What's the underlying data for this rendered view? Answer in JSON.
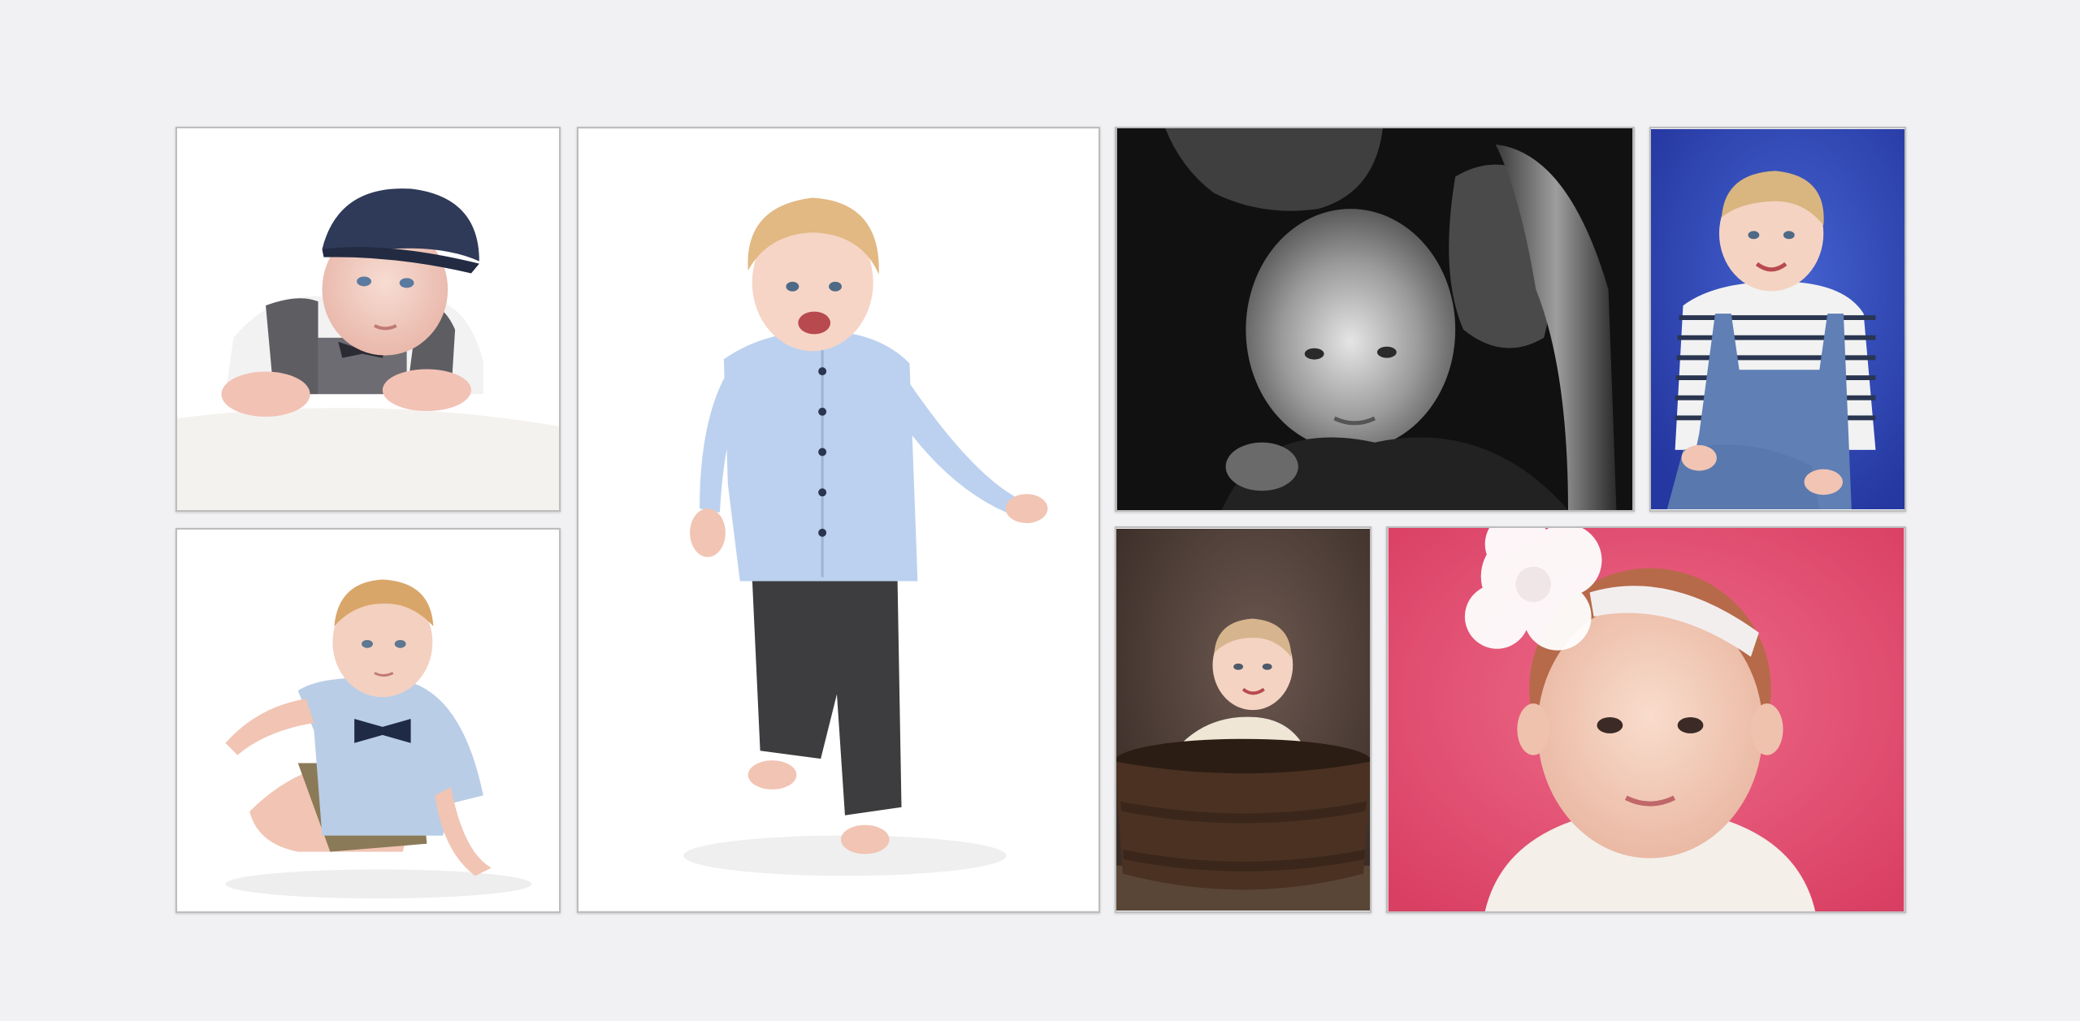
{
  "gallery": {
    "background": "#f1f1f3",
    "frame_color": "#bdbdbd",
    "photos": [
      {
        "subject": "baby-flat-cap-on-white",
        "background": "#ffffff"
      },
      {
        "subject": "baby-bow-tie-sitting-on-white",
        "background": "#ffffff"
      },
      {
        "subject": "toddler-walking-blue-shirt-on-white",
        "background": "#ffffff"
      },
      {
        "subject": "baby-with-parents-black-and-white",
        "background": "#121212"
      },
      {
        "subject": "baby-dungarees-on-blue",
        "background": "#2f49b5"
      },
      {
        "subject": "baby-in-wooden-tub-on-brown",
        "background": "#4a3a33"
      },
      {
        "subject": "baby-flower-headband-on-pink",
        "background": "#e1496d"
      }
    ]
  }
}
